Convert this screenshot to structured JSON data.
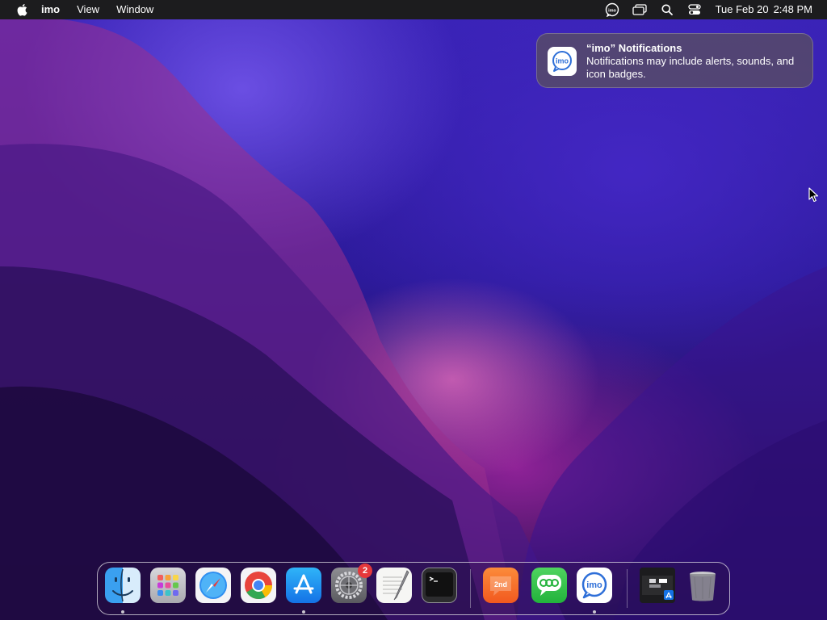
{
  "menubar": {
    "app_name": "imo",
    "menus": [
      "View",
      "Window"
    ],
    "status_icons": [
      "imo-menubar-icon",
      "screen-mirroring-icon",
      "spotlight-search-icon",
      "control-center-icon"
    ],
    "clock": {
      "date": "Tue Feb 20",
      "time": "2:48 PM"
    }
  },
  "notification": {
    "title": "“imo” Notifications",
    "body": "Notifications may include alerts, sounds, and icon badges.",
    "icon": "imo-app-icon"
  },
  "dock": {
    "apps": [
      {
        "name": "Finder",
        "icon": "finder-icon",
        "running": true
      },
      {
        "name": "Launchpad",
        "icon": "launchpad-icon",
        "running": false
      },
      {
        "name": "Safari",
        "icon": "safari-icon",
        "running": false
      },
      {
        "name": "Google Chrome",
        "icon": "chrome-icon",
        "running": false
      },
      {
        "name": "App Store",
        "icon": "app-store-icon",
        "running": true
      },
      {
        "name": "System Settings",
        "icon": "system-settings-icon",
        "running": false,
        "badge": "2"
      },
      {
        "name": "TextEdit",
        "icon": "textedit-icon",
        "running": false
      },
      {
        "name": "Terminal",
        "icon": "terminal-icon",
        "running": false
      }
    ],
    "recent_apps": [
      {
        "name": "2nd Line",
        "icon": "2ndline-icon",
        "label": "2nd",
        "running": false
      },
      {
        "name": "Messenger",
        "icon": "green-messenger-icon",
        "running": false
      },
      {
        "name": "imo",
        "icon": "imo-app-icon",
        "label": "imo",
        "running": true
      }
    ],
    "extras": [
      {
        "name": "Downloads",
        "icon": "downloads-stack-icon"
      },
      {
        "name": "Trash",
        "icon": "trash-icon"
      }
    ]
  },
  "colors": {
    "menubar": "#1c1c1e",
    "badge": "#e5383b",
    "imo_blue": "#2e6fd8"
  }
}
